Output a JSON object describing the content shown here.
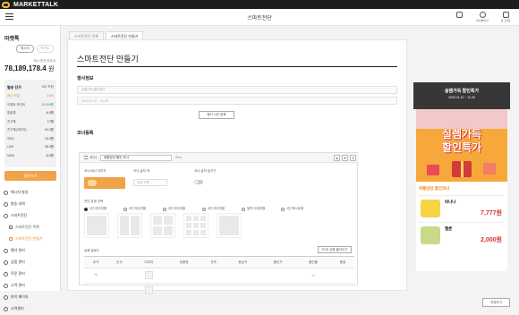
{
  "brand": {
    "name": "MARKETTALK"
  },
  "header": {
    "title": "스마트전단",
    "icons": [
      {
        "icon": "store-icon",
        "label": ""
      },
      {
        "icon": "user-icon",
        "label": "마이페이지"
      },
      {
        "icon": "logout-icon",
        "label": "로그아웃"
      }
    ]
  },
  "sidebar": {
    "store_name": "마켓톡",
    "pills": [
      "메시지",
      "포인트"
    ],
    "cash_caption": "캐시 충전/보유금",
    "cash_amount": "78,189,178.4",
    "cash_unit": "원",
    "box_title": "발송 단가",
    "box_vat": "VAT 포함",
    "rates": [
      {
        "k": "캐시 적립",
        "v": "2.5%",
        "style": "orange"
      },
      {
        "k": "이벤트 포인트",
        "v": "13,000원",
        "style": "green"
      },
      {
        "k": "알림톡",
        "v": "6.8원",
        "style": ""
      },
      {
        "k": "친구톡",
        "v": "17원",
        "style": ""
      },
      {
        "k": "친구톡(이미지)",
        "v": "24.2원",
        "style": ""
      },
      {
        "k": "SMS",
        "v": "10.2원",
        "style": ""
      },
      {
        "k": "LMS",
        "v": "35.2원",
        "style": ""
      },
      {
        "k": "MMS",
        "v": "112원",
        "style": ""
      }
    ],
    "charge_label": "충전하기",
    "nav": [
      {
        "label": "메시지 발송",
        "sub": false,
        "active": false
      },
      {
        "label": "발송 내역",
        "sub": false,
        "active": false
      },
      {
        "label": "스마트전단",
        "sub": false,
        "active": false
      },
      {
        "label": "스마트전단 목록",
        "sub": true,
        "active": false
      },
      {
        "label": "스마트전단 만들기",
        "sub": true,
        "active": true
      },
      {
        "label": "행사 관리",
        "sub": false,
        "active": false
      },
      {
        "label": "상품 관리",
        "sub": false,
        "active": false
      },
      {
        "label": "주문 관리",
        "sub": false,
        "active": false
      },
      {
        "label": "고객 관리",
        "sub": false,
        "active": false
      },
      {
        "label": "마이 페이지",
        "sub": false,
        "active": false
      },
      {
        "label": "고객센터",
        "sub": false,
        "active": false
      }
    ]
  },
  "tabs": [
    "스마트전단 목록",
    "스마트전단 만들기"
  ],
  "page": {
    "title": "스마트전단 만들기",
    "event_section": "행사정보",
    "event_title_placeholder": "실렘가득 할인특가",
    "event_date": "2023.11.10 ~ 11.30",
    "event_image_button": "행사 사진 등록",
    "corner_section": "코너등록",
    "corner": {
      "label": "코너1",
      "name": "위통당당 할인 코너",
      "count": "9/16",
      "icons": [
        "▲",
        "▼",
        "✕"
      ],
      "image_label": "코너 배너 이미지",
      "title_label": "코너 글자 색",
      "title_input": "색상 선택",
      "hide_label": "코너 글자 숨기기",
      "layout_label": "전단 유형 선택",
      "layouts": [
        "1단 이미지형",
        "2단 이미지형",
        "3단 이미지형",
        "4단 이미지형",
        "일반 이미지형",
        "1단 텍스트형"
      ],
      "selected_layout": 0,
      "products_label": "상품 업로드",
      "pos_button": "POS 상품 불러오기",
      "columns": [
        "추가",
        "순서",
        "이미지",
        "상품명",
        "규격",
        "정상가",
        "할인가",
        "할인율",
        "품절"
      ],
      "rows": [
        {
          "add": "+",
          "order": "",
          "name": "",
          "spec": "",
          "price": "",
          "sale": "",
          "rate": "%",
          "soldout": ""
        },
        {
          "add": "",
          "order": "",
          "name": "",
          "spec": "",
          "price": "",
          "sale": "",
          "rate": "",
          "soldout": ""
        }
      ]
    }
  },
  "preview": {
    "title": "실렘가득 할인특가",
    "date": "2023.11.10 ~ 11.30",
    "banner_line1": "실렘가득",
    "banner_line2": "할인특가",
    "corner_title": "위통당당 할인코너",
    "products": [
      {
        "name": "바나나",
        "price": "7,777원",
        "color": "#f5d445"
      },
      {
        "name": "멜론",
        "price": "2,000원",
        "color": "#c9d98a"
      }
    ],
    "save_button": "저장하기"
  }
}
